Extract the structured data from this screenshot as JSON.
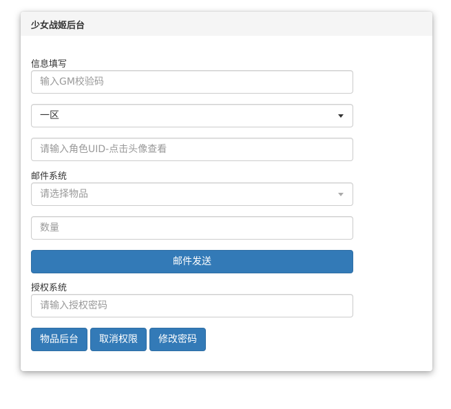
{
  "panel": {
    "title": "少女战姬后台"
  },
  "info_section": {
    "label": "信息填写",
    "gm_code_placeholder": "输入GM校验码",
    "server_select_value": "一区",
    "role_uid_placeholder": "请输入角色UID-点击头像查看"
  },
  "mail_section": {
    "label": "邮件系统",
    "item_select_placeholder": "请选择物品",
    "quantity_placeholder": "数量",
    "send_button": "邮件发送"
  },
  "auth_section": {
    "label": "授权系统",
    "password_placeholder": "请输入授权密码",
    "buttons": {
      "item_backend": "物品后台",
      "cancel_permission": "取消权限",
      "change_password": "修改密码"
    }
  },
  "colors": {
    "primary": "#337ab7",
    "heading_bg": "#f5f5f5",
    "border": "#cccccc"
  }
}
